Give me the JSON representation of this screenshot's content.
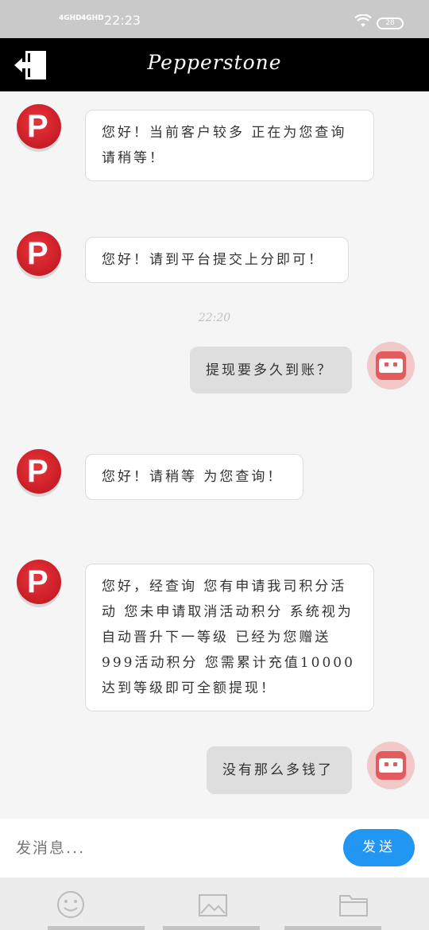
{
  "status_bar": {
    "network_1": "4GHD",
    "network_2": "4GHD",
    "time": "22:23",
    "battery": "28"
  },
  "header": {
    "title": "Pepperstone",
    "exit_icon": "exit-icon"
  },
  "messages": [
    {
      "from": "agent",
      "text": "您好！当前客户较多 正在为您查询请稍等！"
    },
    {
      "from": "agent",
      "text": "您好！请到平台提交上分即可！"
    },
    {
      "from": "user",
      "text": "提现要多久到账？"
    },
    {
      "from": "agent",
      "text": "您好！请稍等 为您查询！"
    },
    {
      "from": "agent",
      "text": "您好，经查询 您有申请我司积分活动 您未申请取消活动积分 系统视为自动晋升下一等级 已经为您赠送999活动积分 您需累计充值10000达到等级即可全额提现！"
    },
    {
      "from": "user",
      "text": "没有那么多钱了"
    }
  ],
  "timestamp": "22:20",
  "composer": {
    "placeholder": "发消息...",
    "send_label": "发送"
  },
  "toolbar": {
    "icons": [
      "smiley-icon",
      "image-icon",
      "folder-icon"
    ]
  },
  "colors": {
    "header_bg": "#000000",
    "send_button": "#2196f3",
    "agent_avatar": "#c81d26",
    "user_avatar": "#e25b5f"
  }
}
